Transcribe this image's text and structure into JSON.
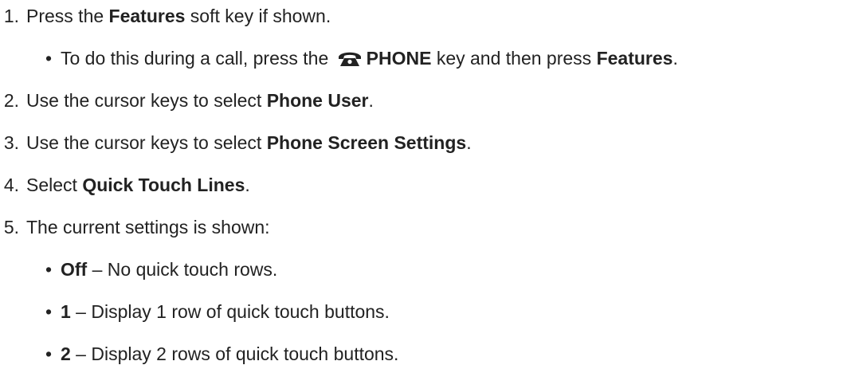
{
  "steps": [
    {
      "number": "1.",
      "pre": "Press the ",
      "bold": "Features",
      "post": " soft key if shown.",
      "sub": {
        "bullet": "•",
        "pre": "To do this during a call, press the ",
        "icon": "phone-icon",
        "bold1": "PHONE",
        "mid": " key and then press ",
        "bold2": "Features",
        "post": "."
      }
    },
    {
      "number": "2.",
      "pre": "Use the cursor keys to select ",
      "bold": "Phone User",
      "post": "."
    },
    {
      "number": "3.",
      "pre": "Use the cursor keys to select ",
      "bold": "Phone Screen Settings",
      "post": "."
    },
    {
      "number": "4.",
      "pre": "Select ",
      "bold": "Quick Touch Lines",
      "post": "."
    },
    {
      "number": "5.",
      "text": "The current settings is shown:",
      "options": [
        {
          "bullet": "•",
          "bold": "Off",
          "desc": " – No quick touch rows."
        },
        {
          "bullet": "•",
          "bold": "1",
          "desc": " – Display 1 row of quick touch buttons."
        },
        {
          "bullet": "•",
          "bold": "2",
          "desc": " – Display 2 rows of quick touch buttons."
        }
      ]
    }
  ]
}
